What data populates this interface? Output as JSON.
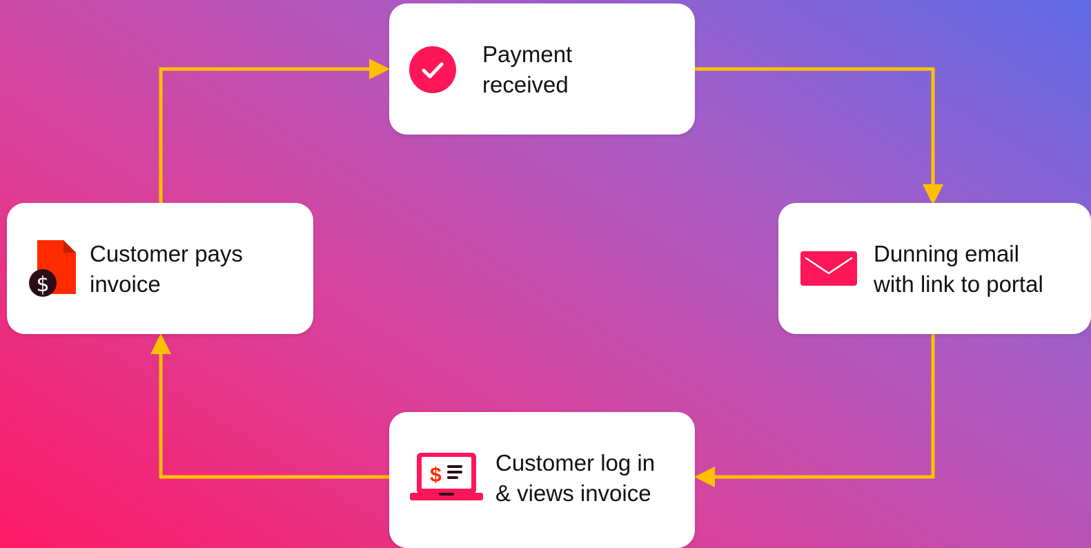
{
  "diagram": {
    "type": "cycle",
    "nodes": [
      {
        "id": "payment",
        "icon": "check-circle-icon",
        "lines": [
          "Payment",
          "received"
        ]
      },
      {
        "id": "dunning",
        "icon": "envelope-icon",
        "lines": [
          "Dunning email",
          "with link to portal"
        ]
      },
      {
        "id": "login",
        "icon": "laptop-invoice-icon",
        "lines": [
          "Customer log in",
          "& views invoice"
        ]
      },
      {
        "id": "pays",
        "icon": "invoice-document-icon",
        "lines": [
          "Customer pays",
          "invoice"
        ]
      }
    ],
    "edges": [
      {
        "from": "payment",
        "to": "dunning"
      },
      {
        "from": "dunning",
        "to": "login"
      },
      {
        "from": "login",
        "to": "pays"
      },
      {
        "from": "pays",
        "to": "payment"
      }
    ]
  },
  "colors": {
    "connector": "#ffc000",
    "icon_accent": "#ff1658",
    "invoice_red": "#ff2a00",
    "coin_dark": "#2b0d18",
    "background_start": "#ff1a66",
    "background_end": "#5e6ae6"
  }
}
